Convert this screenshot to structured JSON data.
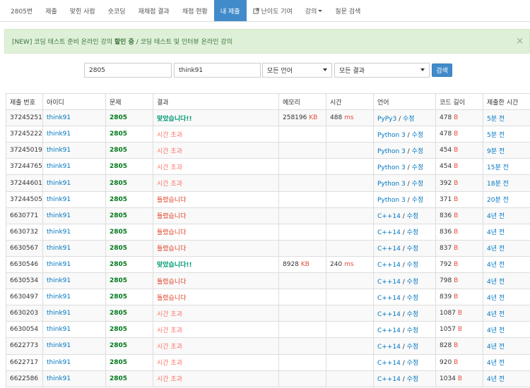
{
  "nav": {
    "items": [
      {
        "label": "2805번",
        "active": false
      },
      {
        "label": "제출",
        "active": false
      },
      {
        "label": "맞힌 사람",
        "active": false
      },
      {
        "label": "숏코딩",
        "active": false
      },
      {
        "label": "재채점 결과",
        "active": false
      },
      {
        "label": "채점 현황",
        "active": false
      },
      {
        "label": "내 제출",
        "active": true
      },
      {
        "label": "난이도 기여",
        "active": false,
        "icon": "external-link-icon"
      },
      {
        "label": "강의",
        "active": false,
        "dropdown": true
      },
      {
        "label": "질문 검색",
        "active": false
      }
    ]
  },
  "alert": {
    "prefix": "[NEW] 코딩 테스트 준비 온라인 강의 ",
    "highlight": "할인 중",
    "suffix": " / 코딩 테스트 및 인터뷰 온라인 강의",
    "close": "×"
  },
  "search": {
    "problem_value": "2805",
    "user_value": "think91",
    "language_selected": "모든 언어",
    "result_selected": "모든 결과",
    "button_label": "검색"
  },
  "table": {
    "headers": [
      "제출 번호",
      "아이디",
      "문제",
      "결과",
      "메모리",
      "시간",
      "언어",
      "코드 길이",
      "제출한 시간"
    ],
    "edit_label": "수정",
    "rows": [
      {
        "id": "37245251",
        "user": "think91",
        "problem": "2805",
        "result": "맞았습니다!!",
        "status": "ac",
        "memory": "258196",
        "memory_unit": "KB",
        "time": "488",
        "time_unit": "ms",
        "lang": "PyPy3",
        "length": "478",
        "length_unit": "B",
        "submitted": "5분 전"
      },
      {
        "id": "37245222",
        "user": "think91",
        "problem": "2805",
        "result": "시간 초과",
        "status": "tle",
        "memory": "",
        "memory_unit": "",
        "time": "",
        "time_unit": "",
        "lang": "Python 3",
        "length": "478",
        "length_unit": "B",
        "submitted": "5분 전"
      },
      {
        "id": "37245019",
        "user": "think91",
        "problem": "2805",
        "result": "시간 초과",
        "status": "tle",
        "memory": "",
        "memory_unit": "",
        "time": "",
        "time_unit": "",
        "lang": "Python 3",
        "length": "454",
        "length_unit": "B",
        "submitted": "9분 전"
      },
      {
        "id": "37244765",
        "user": "think91",
        "problem": "2805",
        "result": "시간 초과",
        "status": "tle",
        "memory": "",
        "memory_unit": "",
        "time": "",
        "time_unit": "",
        "lang": "Python 3",
        "length": "454",
        "length_unit": "B",
        "submitted": "15분 전"
      },
      {
        "id": "37244601",
        "user": "think91",
        "problem": "2805",
        "result": "시간 초과",
        "status": "tle",
        "memory": "",
        "memory_unit": "",
        "time": "",
        "time_unit": "",
        "lang": "Python 3",
        "length": "392",
        "length_unit": "B",
        "submitted": "18분 전"
      },
      {
        "id": "37244505",
        "user": "think91",
        "problem": "2805",
        "result": "틀렸습니다",
        "status": "wa",
        "memory": "",
        "memory_unit": "",
        "time": "",
        "time_unit": "",
        "lang": "Python 3",
        "length": "371",
        "length_unit": "B",
        "submitted": "20분 전"
      },
      {
        "id": "6630771",
        "user": "think91",
        "problem": "2805",
        "result": "틀렸습니다",
        "status": "wa",
        "memory": "",
        "memory_unit": "",
        "time": "",
        "time_unit": "",
        "lang": "C++14",
        "length": "836",
        "length_unit": "B",
        "submitted": "4년 전"
      },
      {
        "id": "6630732",
        "user": "think91",
        "problem": "2805",
        "result": "틀렸습니다",
        "status": "wa",
        "memory": "",
        "memory_unit": "",
        "time": "",
        "time_unit": "",
        "lang": "C++14",
        "length": "836",
        "length_unit": "B",
        "submitted": "4년 전"
      },
      {
        "id": "6630567",
        "user": "think91",
        "problem": "2805",
        "result": "틀렸습니다",
        "status": "wa",
        "memory": "",
        "memory_unit": "",
        "time": "",
        "time_unit": "",
        "lang": "C++14",
        "length": "837",
        "length_unit": "B",
        "submitted": "4년 전"
      },
      {
        "id": "6630546",
        "user": "think91",
        "problem": "2805",
        "result": "맞았습니다!!",
        "status": "ac",
        "memory": "8928",
        "memory_unit": "KB",
        "time": "240",
        "time_unit": "ms",
        "lang": "C++14",
        "length": "792",
        "length_unit": "B",
        "submitted": "4년 전"
      },
      {
        "id": "6630534",
        "user": "think91",
        "problem": "2805",
        "result": "틀렸습니다",
        "status": "wa",
        "memory": "",
        "memory_unit": "",
        "time": "",
        "time_unit": "",
        "lang": "C++14",
        "length": "798",
        "length_unit": "B",
        "submitted": "4년 전"
      },
      {
        "id": "6630497",
        "user": "think91",
        "problem": "2805",
        "result": "틀렸습니다",
        "status": "wa",
        "memory": "",
        "memory_unit": "",
        "time": "",
        "time_unit": "",
        "lang": "C++14",
        "length": "839",
        "length_unit": "B",
        "submitted": "4년 전"
      },
      {
        "id": "6630203",
        "user": "think91",
        "problem": "2805",
        "result": "시간 초과",
        "status": "tle",
        "memory": "",
        "memory_unit": "",
        "time": "",
        "time_unit": "",
        "lang": "C++14",
        "length": "1087",
        "length_unit": "B",
        "submitted": "4년 전"
      },
      {
        "id": "6630054",
        "user": "think91",
        "problem": "2805",
        "result": "시간 초과",
        "status": "tle",
        "memory": "",
        "memory_unit": "",
        "time": "",
        "time_unit": "",
        "lang": "C++14",
        "length": "1057",
        "length_unit": "B",
        "submitted": "4년 전"
      },
      {
        "id": "6622773",
        "user": "think91",
        "problem": "2805",
        "result": "시간 초과",
        "status": "tle",
        "memory": "",
        "memory_unit": "",
        "time": "",
        "time_unit": "",
        "lang": "C++14",
        "length": "828",
        "length_unit": "B",
        "submitted": "4년 전"
      },
      {
        "id": "6622717",
        "user": "think91",
        "problem": "2805",
        "result": "시간 초과",
        "status": "tle",
        "memory": "",
        "memory_unit": "",
        "time": "",
        "time_unit": "",
        "lang": "C++14",
        "length": "920",
        "length_unit": "B",
        "submitted": "4년 전"
      },
      {
        "id": "6622586",
        "user": "think91",
        "problem": "2805",
        "result": "시간 초과",
        "status": "tle",
        "memory": "",
        "memory_unit": "",
        "time": "",
        "time_unit": "",
        "lang": "C++14",
        "length": "1034",
        "length_unit": "B",
        "submitted": "4년 전"
      }
    ]
  }
}
